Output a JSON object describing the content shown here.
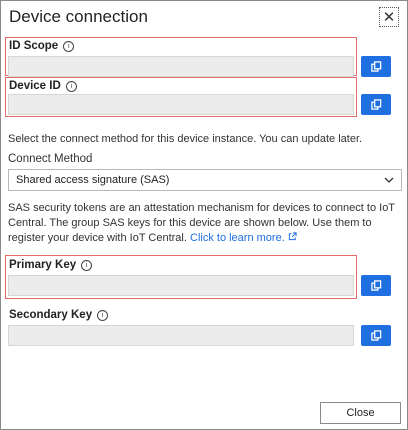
{
  "dialog": {
    "title": "Device connection",
    "close_icon_glyph": "✕"
  },
  "fields": {
    "id_scope": {
      "label": "ID Scope",
      "value": ""
    },
    "device_id": {
      "label": "Device ID",
      "value": ""
    },
    "primary_key": {
      "label": "Primary Key",
      "value": ""
    },
    "secondary_key": {
      "label": "Secondary Key",
      "value": ""
    }
  },
  "info_icon_glyph": "i",
  "connect": {
    "description": "Select the connect method for this device instance. You can update later.",
    "method_label": "Connect Method",
    "method_selected": "Shared access signature (SAS)"
  },
  "sas": {
    "description": "SAS security tokens are an attestation mechanism for devices to connect to IoT Central. The group SAS keys for this device are shown below. Use them to register your device with IoT Central.",
    "link_text": "Click to learn more."
  },
  "footer": {
    "close_label": "Close"
  },
  "colors": {
    "accent": "#1f6fe0",
    "highlight": "#e56a6a",
    "field_bg": "#ececec"
  },
  "icons": [
    "close-icon",
    "info-icon",
    "copy-icon",
    "chevron-down-icon",
    "external-link-icon"
  ]
}
